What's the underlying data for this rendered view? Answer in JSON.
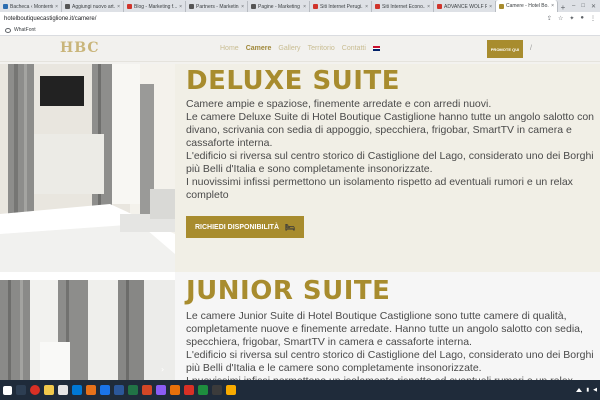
{
  "browser": {
    "tabs": [
      {
        "title": "Bacheca ‹ Monterrin...",
        "color": "#2b6cb0"
      },
      {
        "title": "Aggiungi nuovo art...",
        "color": "#555555"
      },
      {
        "title": "Blog - Marketing f...",
        "color": "#d0342c"
      },
      {
        "title": "Partners - Marketin...",
        "color": "#555555"
      },
      {
        "title": "Pagine - Marketing ...",
        "color": "#555555"
      },
      {
        "title": "Siti Internet Perugi...",
        "color": "#d0342c"
      },
      {
        "title": "Siti Internet Econo...",
        "color": "#d0342c"
      },
      {
        "title": "ADVANCE WOLF P...",
        "color": "#d0342c"
      },
      {
        "title": "Camere - Hotel Bo...",
        "color": "#a88c2e",
        "active": true
      }
    ],
    "new_tab": "+",
    "url": "hotelboutiquecastiglione.it/camere/",
    "bookmark": "WhatFont"
  },
  "site": {
    "logo": "HBC",
    "nav": [
      "Home",
      "Camere",
      "Gallery",
      "Territorio",
      "Contatti"
    ],
    "nav_active": "Camere",
    "promo_button": "PROMOTE QUI",
    "slash": "/"
  },
  "rooms": [
    {
      "title": "DELUXE SUITE",
      "description": "Camere ampie e spaziose, finemente arredate e con arredi nuovi.\nLe camere Deluxe Suite di Hotel Boutique Castiglione hanno tutte un angolo salotto con divano, scrivania con sedia di appoggio, specchiera, frigobar, SmartTV in camera e cassaforte interna.\nL'edificio si riversa sul centro storico di Castiglione del Lago, considerato uno dei Borghi più Belli d'Italia e sono completamente insonorizzate.\nI nuovissimi infissi permettono un isolamento rispetto ad eventuali rumori e un relax completo",
      "cta": "RICHIEDI DISPONIBILITÀ",
      "cta_icon": "bed-icon"
    },
    {
      "title": "JUNIOR SUITE",
      "description": "Le camere Junior Suite di Hotel Boutique Castiglione sono tutte camere di qualità, completamente nuove e finemente arredate. Hanno tutte un angolo salotto con sedia, specchiera, frigobar, SmartTV in camera e cassaforte interna.\nL'edificio si riversa sul centro storico di Castiglione del Lago, considerato uno dei Borghi più Belli d'Italia e le camere sono completamente insonorizzate.\nI nuovissimi infissi permettono un isolamento rispetto ad eventuali rumori e un relax"
    }
  ],
  "colors": {
    "accent": "#a88c2e",
    "title": "#a88c2e",
    "text": "#4a4a4a",
    "taskbar": "#1f2b3a"
  }
}
